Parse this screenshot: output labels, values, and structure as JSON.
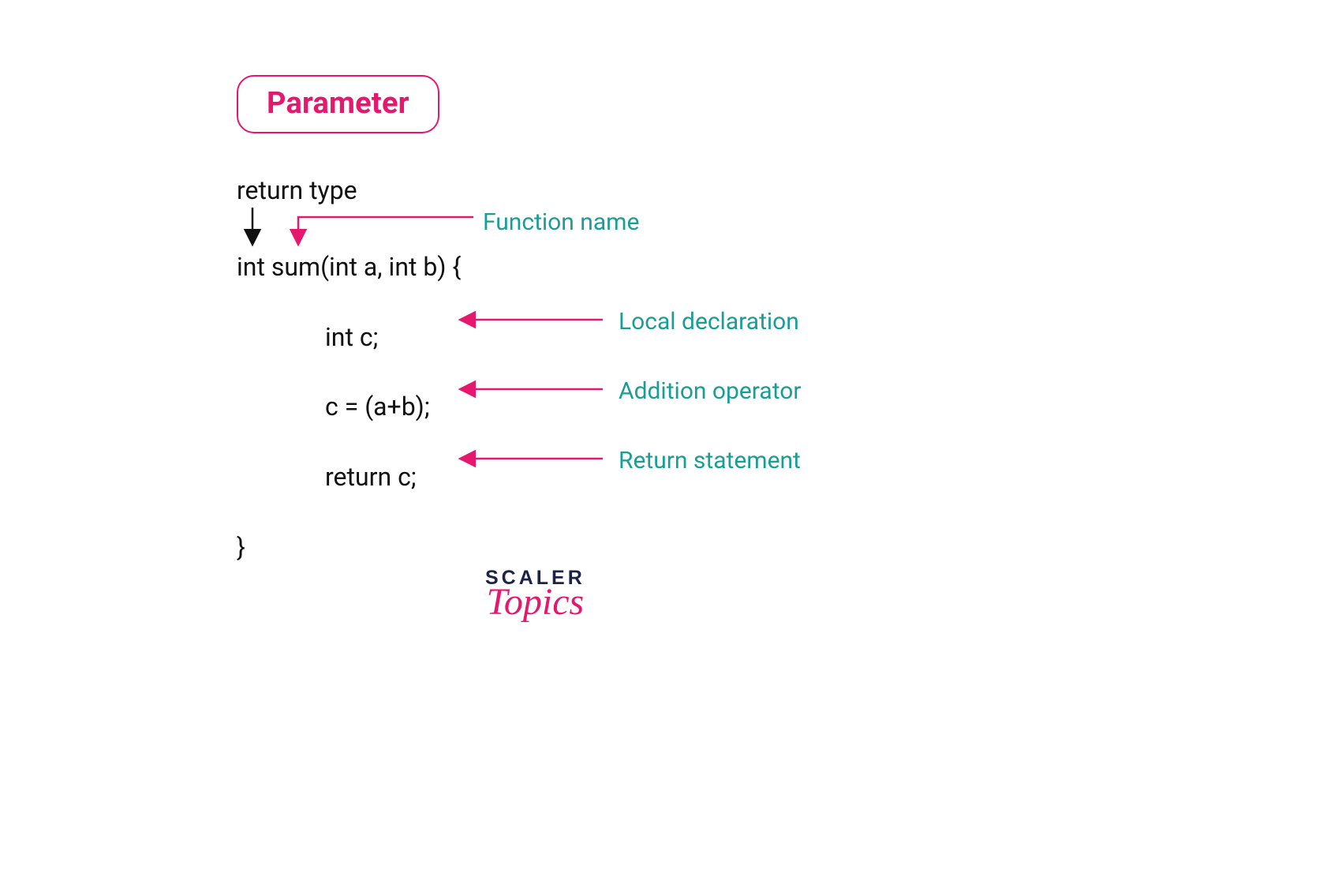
{
  "header": {
    "box_label": "Parameter"
  },
  "code": {
    "return_type_label": "return type",
    "signature": "int sum(int a, int b) {",
    "line_local": "int c;",
    "line_assign": "c = (a+b);",
    "line_return": "return c;",
    "close": "}"
  },
  "annotations": {
    "function_name": "Function name",
    "local_decl": "Local declaration",
    "add_op": "Addition operator",
    "return_stmt": "Return statement"
  },
  "colors": {
    "accent": "#e5186d",
    "teal": "#1a9d95",
    "text": "#111111",
    "logo_dark": "#1d2246"
  },
  "logo": {
    "line1": "SCALER",
    "line2": "Topics"
  }
}
